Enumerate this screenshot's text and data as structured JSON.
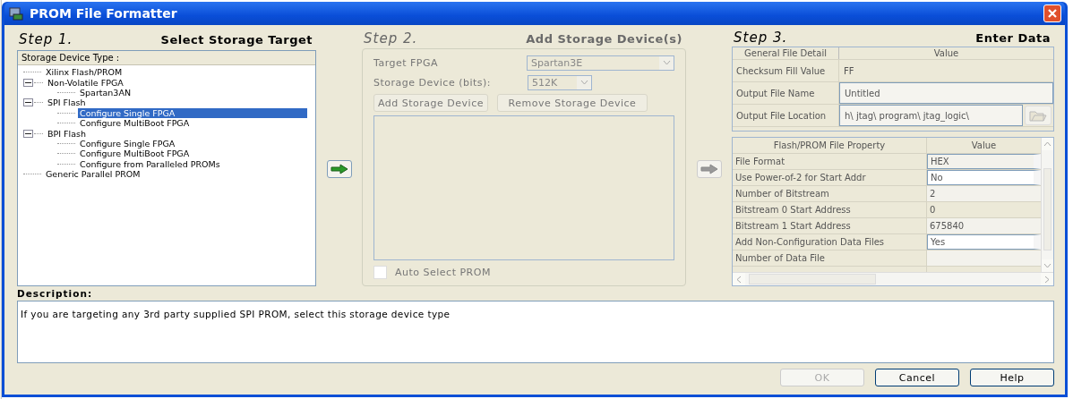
{
  "window": {
    "title": "PROM File Formatter"
  },
  "step1": {
    "step": "Step 1.",
    "title": "Select Storage Target",
    "tree_header": "Storage Device Type :",
    "tree": [
      {
        "label": "Xilinx Flash/PROM",
        "selected": false
      },
      {
        "label": "Non-Volatile FPGA",
        "expanded": true,
        "selected": false,
        "children": [
          {
            "label": "Spartan3AN",
            "selected": false
          }
        ]
      },
      {
        "label": "SPI Flash",
        "expanded": true,
        "selected": false,
        "children": [
          {
            "label": "Configure Single FPGA",
            "selected": true
          },
          {
            "label": "Configure MultiBoot FPGA",
            "selected": false
          }
        ]
      },
      {
        "label": "BPI Flash",
        "expanded": true,
        "selected": false,
        "children": [
          {
            "label": "Configure Single FPGA",
            "selected": false
          },
          {
            "label": "Configure MultiBoot FPGA",
            "selected": false
          },
          {
            "label": "Configure from Paralleled PROMs",
            "selected": false
          }
        ]
      },
      {
        "label": "Generic Parallel PROM",
        "selected": false
      }
    ],
    "next_disabled": false
  },
  "step2": {
    "step": "Step 2.",
    "title": "Add Storage Device(s)",
    "disabled": true,
    "target_label": "Target FPGA",
    "target_value": "Spartan3E",
    "size_label": "Storage Device (bits):",
    "size_value": "512K",
    "add_button": "Add Storage Device",
    "remove_button": "Remove Storage Device",
    "auto_select": {
      "label": "Auto Select PROM",
      "checked": false
    },
    "next_disabled": true
  },
  "step3": {
    "step": "Step 3.",
    "title": "Enter Data",
    "general": {
      "columns": [
        "General File Detail",
        "Value"
      ],
      "rows": [
        {
          "name": "Checksum Fill Value",
          "value": "FF",
          "kind": "readonly"
        },
        {
          "name": "Output File Name",
          "value": "Untitled",
          "kind": "field"
        },
        {
          "name": "Output File Location",
          "value": "h\\  jtag\\  program\\  jtag_logic\\",
          "kind": "browse"
        }
      ]
    },
    "properties": {
      "columns": [
        "Flash/PROM File Property",
        "Value"
      ],
      "rows": [
        {
          "name": "File Format",
          "value": "HEX",
          "kind": "combo"
        },
        {
          "name": "Use Power-of-2 for Start Addr",
          "value": "No",
          "kind": "combo"
        },
        {
          "name": "Number of Bitstream",
          "value": "2",
          "kind": "readonly"
        },
        {
          "name": "Bitstream 0 Start Address",
          "value": "0",
          "kind": "readonly"
        },
        {
          "name": "Bitstream 1 Start Address",
          "value": "675840",
          "kind": "readonly"
        },
        {
          "name": "Add Non-Configuration Data Files",
          "value": "Yes",
          "kind": "combo"
        },
        {
          "name": "Number of Data File",
          "kind": "readonly"
        }
      ]
    }
  },
  "description": {
    "label": "Description:",
    "text": "If you are targeting any 3rd party supplied SPI PROM, select this storage device type"
  },
  "buttons": [
    {
      "label": "OK",
      "disabled": true
    },
    {
      "label": "Cancel",
      "disabled": false
    },
    {
      "label": "Help",
      "disabled": false
    }
  ]
}
